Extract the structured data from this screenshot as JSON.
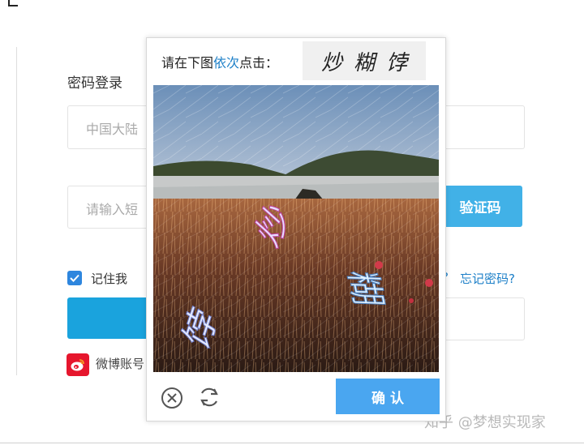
{
  "login": {
    "title": "密码登录",
    "phone_placeholder": "中国大陆",
    "sms_placeholder": "请输入短",
    "sms_button": "验证码",
    "remember_label": "记住我",
    "forgot_password": "忘记密码?",
    "question_mark": "?",
    "weibo_label": "微博账号"
  },
  "captcha": {
    "prompt_prefix": "请在下图",
    "prompt_highlight": "依次",
    "prompt_suffix": "点击：",
    "target_chars": [
      "炒",
      "糊",
      "饽"
    ],
    "image_chars": [
      "炒",
      "糊",
      "饽"
    ],
    "confirm_button": "确 认",
    "close_icon": "close-circle-icon",
    "refresh_icon": "refresh-icon"
  },
  "watermark": "知乎 @梦想实现家",
  "colors": {
    "accent": "#41b1e7",
    "confirm": "#4aa6f0",
    "link": "#1e80c8",
    "weibo": "#e6162d"
  }
}
